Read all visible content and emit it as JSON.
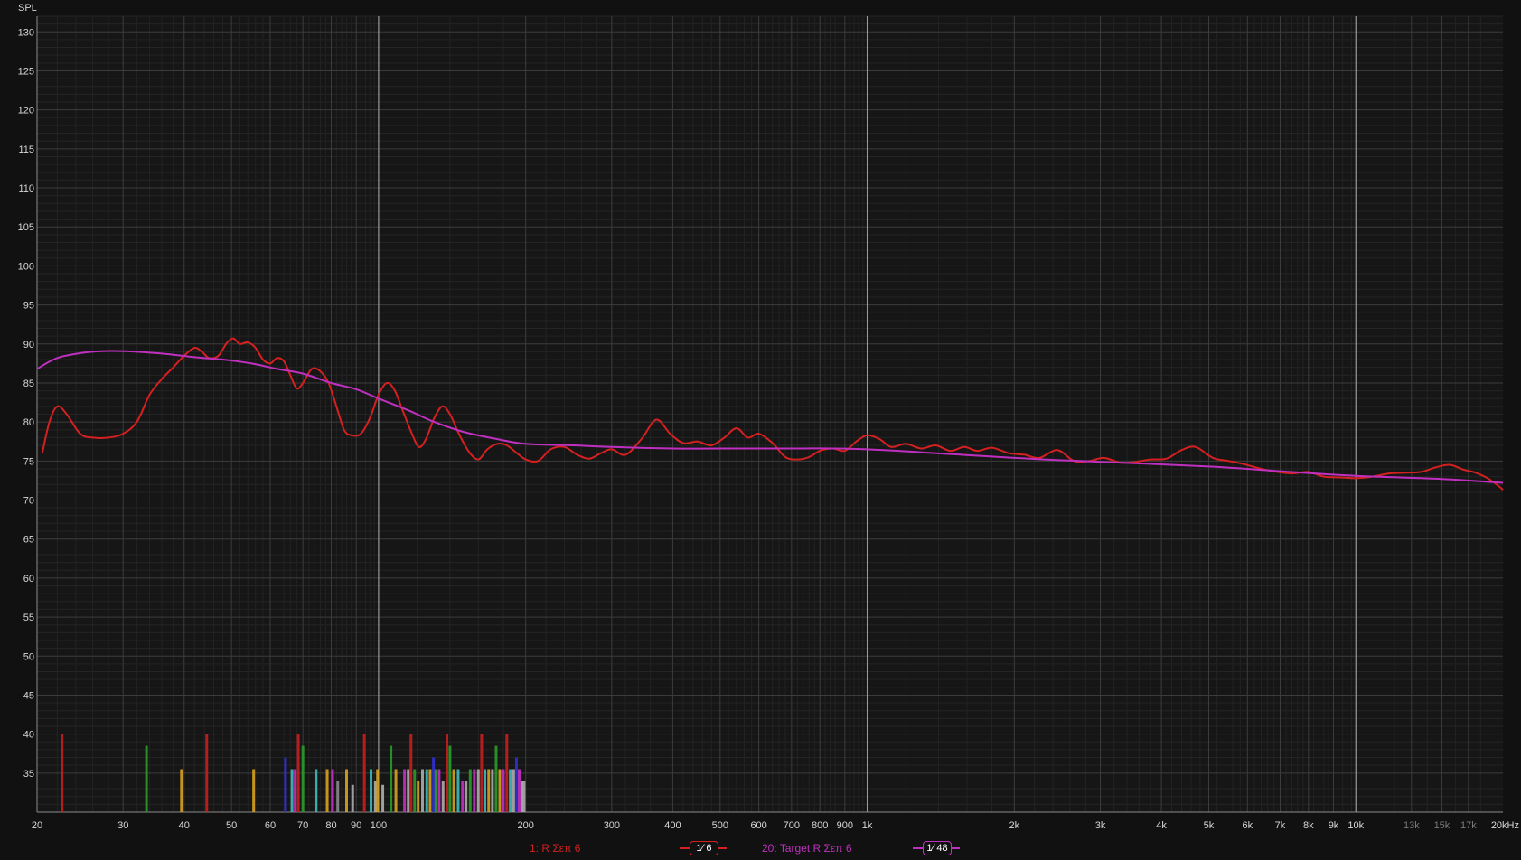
{
  "y_axis_title": "SPL",
  "x_unit_suffix": "kHz",
  "legend": [
    {
      "label": "1: R Σεπ 6",
      "color": "#d42020",
      "smoothing": "1⁄ 6"
    },
    {
      "label": "20: Target R Σεπ 6",
      "color": "#c030c0",
      "smoothing": "1⁄ 48"
    }
  ],
  "chart_data": {
    "type": "line",
    "x_scale": "log",
    "xlim": [
      20,
      20000
    ],
    "ylim": [
      30,
      132
    ],
    "grid": true,
    "ylabel": "SPL",
    "y_ticks": [
      35,
      40,
      45,
      50,
      55,
      60,
      65,
      70,
      75,
      80,
      85,
      90,
      95,
      100,
      105,
      110,
      115,
      120,
      125,
      130
    ],
    "x_ticks": [
      {
        "value": 20,
        "label": "20"
      },
      {
        "value": 30,
        "label": "30"
      },
      {
        "value": 40,
        "label": "40"
      },
      {
        "value": 50,
        "label": "50"
      },
      {
        "value": 60,
        "label": "60"
      },
      {
        "value": 70,
        "label": "70"
      },
      {
        "value": 80,
        "label": "80"
      },
      {
        "value": 90,
        "label": "90"
      },
      {
        "value": 100,
        "label": "100"
      },
      {
        "value": 200,
        "label": "200"
      },
      {
        "value": 300,
        "label": "300"
      },
      {
        "value": 400,
        "label": "400"
      },
      {
        "value": 500,
        "label": "500"
      },
      {
        "value": 600,
        "label": "600"
      },
      {
        "value": 700,
        "label": "700"
      },
      {
        "value": 800,
        "label": "800"
      },
      {
        "value": 900,
        "label": "900"
      },
      {
        "value": 1000,
        "label": "1k"
      },
      {
        "value": 2000,
        "label": "2k"
      },
      {
        "value": 3000,
        "label": "3k"
      },
      {
        "value": 4000,
        "label": "4k"
      },
      {
        "value": 5000,
        "label": "5k"
      },
      {
        "value": 6000,
        "label": "6k"
      },
      {
        "value": 7000,
        "label": "7k"
      },
      {
        "value": 8000,
        "label": "8k"
      },
      {
        "value": 9000,
        "label": "9k"
      },
      {
        "value": 10000,
        "label": "10k"
      },
      {
        "value": 13000,
        "label": "13k",
        "dim": true
      },
      {
        "value": 15000,
        "label": "15k",
        "dim": true
      },
      {
        "value": 17000,
        "label": "17k",
        "dim": true
      },
      {
        "value": 20000,
        "label": "20kHz"
      }
    ],
    "series": [
      {
        "name": "1: R Σεπ 6",
        "color": "#d42020",
        "points": [
          [
            20.5,
            76
          ],
          [
            21.2,
            80
          ],
          [
            22,
            82
          ],
          [
            23,
            81
          ],
          [
            24.5,
            78.5
          ],
          [
            26,
            78
          ],
          [
            28,
            78
          ],
          [
            30,
            78.5
          ],
          [
            32,
            80
          ],
          [
            34,
            83.5
          ],
          [
            36,
            85.5
          ],
          [
            38,
            87
          ],
          [
            40,
            88.5
          ],
          [
            42,
            89.5
          ],
          [
            43.5,
            89
          ],
          [
            45,
            88.2
          ],
          [
            47,
            88.5
          ],
          [
            49,
            90.2
          ],
          [
            50.5,
            90.7
          ],
          [
            52,
            90
          ],
          [
            54,
            90.2
          ],
          [
            56,
            89.5
          ],
          [
            58,
            88
          ],
          [
            60,
            87.5
          ],
          [
            62,
            88.2
          ],
          [
            64,
            87.8
          ],
          [
            66,
            86
          ],
          [
            68,
            84.3
          ],
          [
            70,
            85
          ],
          [
            73,
            86.8
          ],
          [
            76,
            86.5
          ],
          [
            79,
            85
          ],
          [
            82,
            82
          ],
          [
            85,
            79
          ],
          [
            88,
            78.3
          ],
          [
            92,
            78.5
          ],
          [
            96,
            80.5
          ],
          [
            100,
            83.5
          ],
          [
            104,
            85
          ],
          [
            108,
            84
          ],
          [
            112,
            81.5
          ],
          [
            117,
            78.5
          ],
          [
            121,
            76.8
          ],
          [
            125,
            77.8
          ],
          [
            130,
            80.5
          ],
          [
            135,
            82
          ],
          [
            140,
            81
          ],
          [
            146,
            78.5
          ],
          [
            153,
            76.2
          ],
          [
            160,
            75.2
          ],
          [
            167,
            76.5
          ],
          [
            175,
            77.2
          ],
          [
            183,
            77
          ],
          [
            192,
            76
          ],
          [
            200,
            75.2
          ],
          [
            212,
            75
          ],
          [
            225,
            76.5
          ],
          [
            240,
            76.8
          ],
          [
            255,
            75.8
          ],
          [
            270,
            75.3
          ],
          [
            285,
            76
          ],
          [
            300,
            76.5
          ],
          [
            320,
            75.8
          ],
          [
            345,
            77.8
          ],
          [
            370,
            80.3
          ],
          [
            395,
            78.5
          ],
          [
            420,
            77.3
          ],
          [
            450,
            77.5
          ],
          [
            480,
            77
          ],
          [
            510,
            78
          ],
          [
            540,
            79.2
          ],
          [
            570,
            78
          ],
          [
            600,
            78.5
          ],
          [
            640,
            77.3
          ],
          [
            680,
            75.5
          ],
          [
            720,
            75.2
          ],
          [
            760,
            75.5
          ],
          [
            800,
            76.3
          ],
          [
            850,
            76.6
          ],
          [
            900,
            76.3
          ],
          [
            950,
            77.5
          ],
          [
            1000,
            78.3
          ],
          [
            1060,
            77.8
          ],
          [
            1120,
            76.8
          ],
          [
            1200,
            77.2
          ],
          [
            1290,
            76.6
          ],
          [
            1380,
            77
          ],
          [
            1480,
            76.3
          ],
          [
            1580,
            76.8
          ],
          [
            1680,
            76.3
          ],
          [
            1800,
            76.7
          ],
          [
            1950,
            76
          ],
          [
            2100,
            75.8
          ],
          [
            2250,
            75.4
          ],
          [
            2450,
            76.4
          ],
          [
            2650,
            75
          ],
          [
            2850,
            75
          ],
          [
            3050,
            75.4
          ],
          [
            3300,
            74.8
          ],
          [
            3550,
            74.9
          ],
          [
            3800,
            75.2
          ],
          [
            4100,
            75.3
          ],
          [
            4400,
            76.4
          ],
          [
            4700,
            76.8
          ],
          [
            5100,
            75.4
          ],
          [
            5500,
            75
          ],
          [
            5900,
            74.6
          ],
          [
            6400,
            74
          ],
          [
            6900,
            73.6
          ],
          [
            7400,
            73.4
          ],
          [
            8000,
            73.6
          ],
          [
            8600,
            73
          ],
          [
            9300,
            72.9
          ],
          [
            10000,
            72.8
          ],
          [
            10800,
            73
          ],
          [
            11700,
            73.4
          ],
          [
            12600,
            73.5
          ],
          [
            13600,
            73.6
          ],
          [
            14600,
            74.2
          ],
          [
            15600,
            74.5
          ],
          [
            16600,
            73.9
          ],
          [
            17600,
            73.5
          ],
          [
            18600,
            72.8
          ],
          [
            19600,
            71.8
          ],
          [
            20000,
            71.3
          ]
        ]
      },
      {
        "name": "20: Target R Σεπ 6",
        "color": "#c030c0",
        "points": [
          [
            20,
            86.8
          ],
          [
            22,
            88.2
          ],
          [
            25,
            88.9
          ],
          [
            28,
            89.1
          ],
          [
            32,
            89
          ],
          [
            37,
            88.7
          ],
          [
            42,
            88.3
          ],
          [
            48,
            88
          ],
          [
            55,
            87.5
          ],
          [
            62,
            86.8
          ],
          [
            70,
            86.2
          ],
          [
            80,
            85
          ],
          [
            90,
            84.2
          ],
          [
            100,
            83
          ],
          [
            115,
            81.5
          ],
          [
            130,
            80
          ],
          [
            150,
            78.7
          ],
          [
            175,
            77.8
          ],
          [
            200,
            77.2
          ],
          [
            250,
            77
          ],
          [
            300,
            76.8
          ],
          [
            400,
            76.6
          ],
          [
            500,
            76.6
          ],
          [
            700,
            76.6
          ],
          [
            1000,
            76.5
          ],
          [
            2000,
            75.4
          ],
          [
            3000,
            74.9
          ],
          [
            5000,
            74.3
          ],
          [
            7000,
            73.7
          ],
          [
            10000,
            73.1
          ],
          [
            15000,
            72.7
          ],
          [
            20000,
            72.2
          ]
        ]
      }
    ],
    "filter_bars": [
      {
        "freq": 22.5,
        "level": 40,
        "color": "#c42020"
      },
      {
        "freq": 33.5,
        "level": 38.5,
        "color": "#2a9a2a"
      },
      {
        "freq": 39.5,
        "level": 35.5,
        "color": "#d4a020"
      },
      {
        "freq": 44.5,
        "level": 40,
        "color": "#c42020"
      },
      {
        "freq": 55.5,
        "level": 35.5,
        "color": "#d4a020"
      },
      {
        "freq": 64.5,
        "level": 37,
        "color": "#3030d0"
      },
      {
        "freq": 66.5,
        "level": 35.5,
        "color": "#3cb8b8"
      },
      {
        "freq": 67.5,
        "level": 35.5,
        "color": "#c030c0"
      },
      {
        "freq": 68.5,
        "level": 40,
        "color": "#c42020"
      },
      {
        "freq": 70,
        "level": 38.5,
        "color": "#2a9a2a"
      },
      {
        "freq": 74.5,
        "level": 35.5,
        "color": "#3cb8b8"
      },
      {
        "freq": 78.5,
        "level": 35.5,
        "color": "#d4a020"
      },
      {
        "freq": 80.5,
        "level": 35.5,
        "color": "#c030c0"
      },
      {
        "freq": 82.5,
        "level": 34,
        "color": "#888888"
      },
      {
        "freq": 86,
        "level": 35.5,
        "color": "#d4a020"
      },
      {
        "freq": 88.5,
        "level": 33.5,
        "color": "#aaaaaa"
      },
      {
        "freq": 93.5,
        "level": 40,
        "color": "#c42020"
      },
      {
        "freq": 96.5,
        "level": 35.5,
        "color": "#3cb8b8"
      },
      {
        "freq": 98.5,
        "level": 34,
        "color": "#aaaaaa"
      },
      {
        "freq": 99.5,
        "level": 35.5,
        "color": "#d4a020"
      },
      {
        "freq": 102,
        "level": 33.5,
        "color": "#aaaaaa"
      },
      {
        "freq": 106,
        "level": 38.5,
        "color": "#2a9a2a"
      },
      {
        "freq": 108.5,
        "level": 35.5,
        "color": "#d4a020"
      },
      {
        "freq": 113,
        "level": 35.5,
        "color": "#c030c0"
      },
      {
        "freq": 115,
        "level": 35.5,
        "color": "#aaaaaa"
      },
      {
        "freq": 116.5,
        "level": 40,
        "color": "#c42020"
      },
      {
        "freq": 118.5,
        "level": 35.5,
        "color": "#2a9a2a"
      },
      {
        "freq": 120.5,
        "level": 34,
        "color": "#d4a020"
      },
      {
        "freq": 123,
        "level": 35.5,
        "color": "#aaaaaa"
      },
      {
        "freq": 125.5,
        "level": 35.5,
        "color": "#3cb8b8"
      },
      {
        "freq": 127.5,
        "level": 35.5,
        "color": "#d4a020"
      },
      {
        "freq": 129.5,
        "level": 37,
        "color": "#3030d0"
      },
      {
        "freq": 131,
        "level": 35.5,
        "color": "#2a9a2a"
      },
      {
        "freq": 133,
        "level": 35.5,
        "color": "#c030c0"
      },
      {
        "freq": 135.5,
        "level": 34,
        "color": "#aaaaaa"
      },
      {
        "freq": 138,
        "level": 40,
        "color": "#c42020"
      },
      {
        "freq": 140,
        "level": 38.5,
        "color": "#2a9a2a"
      },
      {
        "freq": 142.5,
        "level": 35.5,
        "color": "#d4a020"
      },
      {
        "freq": 145.5,
        "level": 35.5,
        "color": "#3cb8b8"
      },
      {
        "freq": 148.5,
        "level": 34,
        "color": "#c030c0"
      },
      {
        "freq": 151,
        "level": 34,
        "color": "#aaaaaa"
      },
      {
        "freq": 154,
        "level": 35.5,
        "color": "#2a9a2a"
      },
      {
        "freq": 157,
        "level": 35.5,
        "color": "#c030c0"
      },
      {
        "freq": 160,
        "level": 35.5,
        "color": "#aaaaaa"
      },
      {
        "freq": 162.5,
        "level": 40,
        "color": "#c42020"
      },
      {
        "freq": 165,
        "level": 35.5,
        "color": "#3cb8b8"
      },
      {
        "freq": 168,
        "level": 35.5,
        "color": "#d4a020"
      },
      {
        "freq": 171,
        "level": 35.5,
        "color": "#aaaaaa"
      },
      {
        "freq": 174,
        "level": 38.5,
        "color": "#2a9a2a"
      },
      {
        "freq": 177,
        "level": 35.5,
        "color": "#d4a020"
      },
      {
        "freq": 180,
        "level": 35.5,
        "color": "#c030c0"
      },
      {
        "freq": 183,
        "level": 40,
        "color": "#c42020"
      },
      {
        "freq": 186,
        "level": 35.5,
        "color": "#3cb8b8"
      },
      {
        "freq": 189,
        "level": 35.5,
        "color": "#aaaaaa"
      },
      {
        "freq": 191.5,
        "level": 37,
        "color": "#3030d0"
      },
      {
        "freq": 194,
        "level": 35.5,
        "color": "#c030c0"
      },
      {
        "freq": 196.5,
        "level": 34,
        "color": "#aaaaaa"
      },
      {
        "freq": 198.5,
        "level": 34,
        "color": "#aaaaaa"
      }
    ]
  }
}
